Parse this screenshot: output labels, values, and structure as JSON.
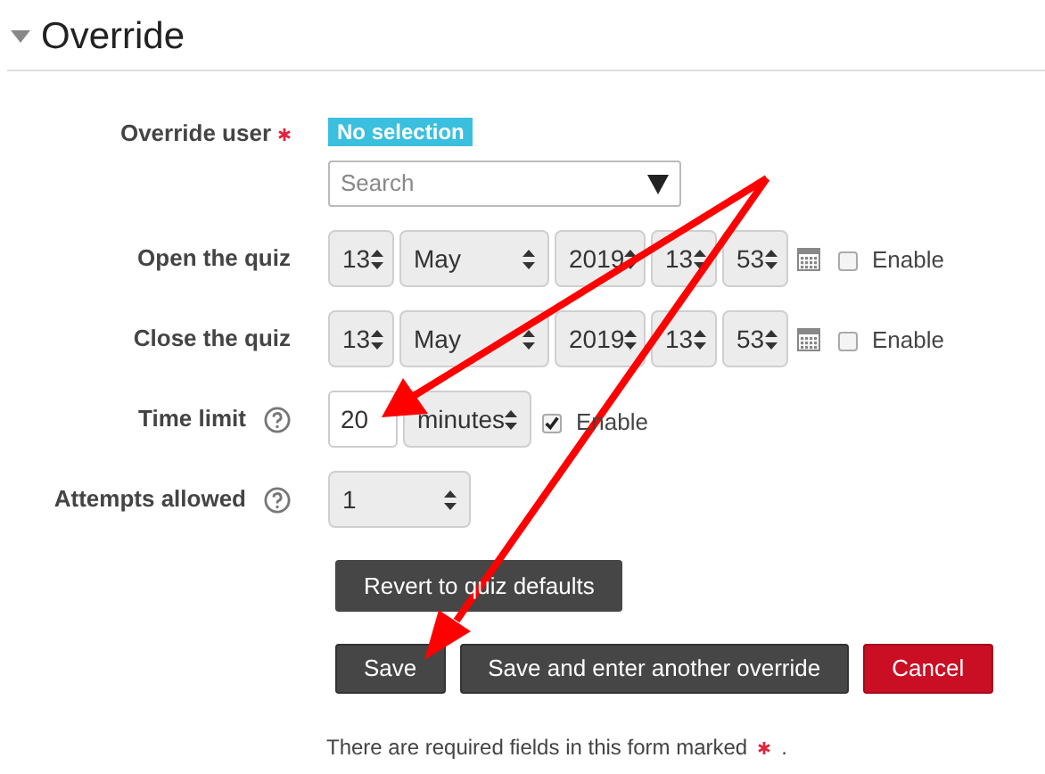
{
  "section": {
    "title": "Override",
    "expanded": true
  },
  "fields": [
    {
      "kind": "user",
      "label": "Override user",
      "required": true,
      "help": false,
      "badge": "No selection",
      "placeholder": "Search"
    },
    {
      "kind": "datetime",
      "label": "Open the quiz",
      "required": false,
      "help": false,
      "parts": [
        "13",
        "May",
        "2019",
        "13",
        "53"
      ],
      "enable": "Enable",
      "checked": false
    },
    {
      "kind": "datetime",
      "label": "Close the quiz",
      "required": false,
      "help": false,
      "parts": [
        "13",
        "May",
        "2019",
        "13",
        "53"
      ],
      "enable": "Enable",
      "checked": false
    },
    {
      "kind": "duration",
      "label": "Time limit",
      "required": false,
      "help": true,
      "value": "20",
      "unit": "minutes",
      "enable": "Enable",
      "checked": true
    },
    {
      "kind": "select",
      "label": "Attempts allowed",
      "required": false,
      "help": true,
      "value": "1"
    }
  ],
  "revert": {
    "label": "Revert to quiz defaults"
  },
  "actions": [
    {
      "label": "Save",
      "kind": "primary"
    },
    {
      "label": "Save and enter another override",
      "kind": "primary"
    },
    {
      "label": "Cancel",
      "kind": "danger"
    }
  ],
  "note": {
    "text": "There are required fields in this form marked",
    "suffix": "."
  }
}
